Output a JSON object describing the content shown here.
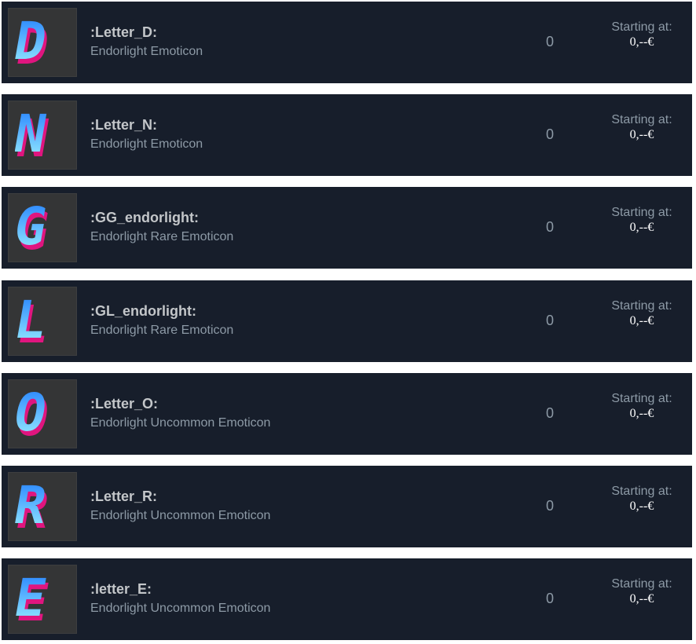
{
  "listings": [
    {
      "letter": "D",
      "name": ":Letter_D:",
      "game_type": "Endorlight Emoticon",
      "quantity": "0",
      "price_label": "Starting at:",
      "price": "0,--€"
    },
    {
      "letter": "N",
      "name": ":Letter_N:",
      "game_type": "Endorlight Emoticon",
      "quantity": "0",
      "price_label": "Starting at:",
      "price": "0,--€"
    },
    {
      "letter": "G",
      "name": ":GG_endorlight:",
      "game_type": "Endorlight Rare Emoticon",
      "quantity": "0",
      "price_label": "Starting at:",
      "price": "0,--€"
    },
    {
      "letter": "L",
      "name": ":GL_endorlight:",
      "game_type": "Endorlight Rare Emoticon",
      "quantity": "0",
      "price_label": "Starting at:",
      "price": "0,--€"
    },
    {
      "letter": "O",
      "name": ":Letter_O:",
      "game_type": "Endorlight Uncommon Emoticon",
      "quantity": "0",
      "price_label": "Starting at:",
      "price": "0,--€"
    },
    {
      "letter": "R",
      "name": ":Letter_R:",
      "game_type": "Endorlight Uncommon Emoticon",
      "quantity": "0",
      "price_label": "Starting at:",
      "price": "0,--€"
    },
    {
      "letter": "E",
      "name": ":letter_E:",
      "game_type": "Endorlight Uncommon Emoticon",
      "quantity": "0",
      "price_label": "Starting at:",
      "price": "0,--€"
    }
  ],
  "colors": {
    "row_background": "#171e2b",
    "emoticon_gradient_top": "#1e7bff",
    "emoticon_gradient_bottom": "#9ff4ff",
    "emoticon_extrude": "#e0157f"
  },
  "icon": "pixel-letter-emoticon-icon"
}
